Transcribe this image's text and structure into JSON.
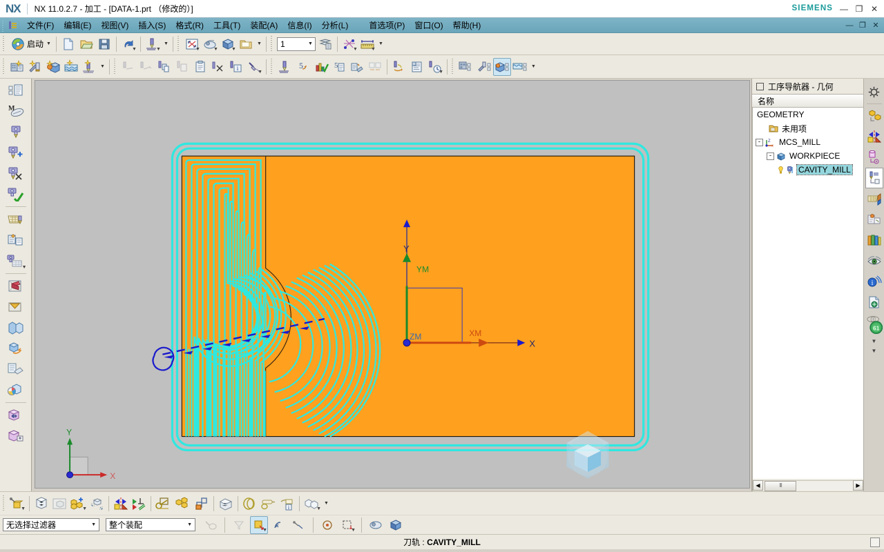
{
  "window": {
    "logo": "NX",
    "title": "NX 11.0.2.7 - 加工 - [DATA-1.prt （修改的）]",
    "brand": "SIEMENS",
    "minimize": "—",
    "restore": "❐",
    "close": "✕"
  },
  "menubar": {
    "items": [
      {
        "label": "文件(F)",
        "key": "F"
      },
      {
        "label": "编辑(E)",
        "key": "E"
      },
      {
        "label": "视图(V)",
        "key": "V"
      },
      {
        "label": "插入(S)",
        "key": "S"
      },
      {
        "label": "格式(R)",
        "key": "R"
      },
      {
        "label": "工具(T)",
        "key": "T"
      },
      {
        "label": "装配(A)",
        "key": "A"
      },
      {
        "label": "信息(I)",
        "key": "I"
      },
      {
        "label": "分析(L)",
        "key": "L"
      },
      {
        "label": "首选项(P)",
        "key": "P"
      },
      {
        "label": "窗口(O)",
        "key": "O"
      },
      {
        "label": "帮助(H)",
        "key": "H"
      }
    ],
    "min": "—",
    "restore": "❐",
    "close": "✕"
  },
  "toolbar_main": {
    "start_label": "启动",
    "value_field": "1",
    "buttons": [
      "start-button",
      "new-file",
      "open-file",
      "save-file",
      "undo",
      "generate-toolpath",
      "fit-view",
      "render-style",
      "shaded-view",
      "layer-settings",
      "display-value",
      "layer-manager",
      "move-object",
      "measure-distance"
    ]
  },
  "toolbar_machining": {
    "buttons": [
      "create-program",
      "create-tool",
      "create-geometry",
      "create-method",
      "create-operation",
      "cut-region",
      "transform-path",
      "copy-path",
      "paste-path",
      "delete-path",
      "path-info",
      "tool-path-list",
      "generate-tool-path",
      "replay-tool-path",
      "verify-tool-path",
      "list-tool-path",
      "post-process",
      "shop-documentation",
      "output-cls-file",
      "machine-code",
      "simulate-time",
      "program-order-view",
      "machine-tool-view",
      "geometry-view",
      "machining-method-view"
    ]
  },
  "navigator": {
    "title": "工序导航器 - 几何",
    "column_header": "名称",
    "tree": [
      {
        "label": "GEOMETRY",
        "depth": 0,
        "expander": "",
        "icon": "",
        "selected": false
      },
      {
        "label": "未用项",
        "depth": 1,
        "expander": "",
        "icon": "unused-items-icon",
        "selected": false
      },
      {
        "label": "MCS_MILL",
        "depth": 1,
        "expander": "-",
        "icon": "mcs-icon",
        "selected": false
      },
      {
        "label": "WORKPIECE",
        "depth": 2,
        "expander": "-",
        "icon": "workpiece-icon",
        "selected": false
      },
      {
        "label": "CAVITY_MILL",
        "depth": 3,
        "expander": "",
        "icon": "cavity-mill-icon",
        "warning": "!",
        "selected": true
      }
    ],
    "scroll_left": "◀",
    "scroll_right": "▶"
  },
  "viewport": {
    "mcs": {
      "x_label": "X",
      "y_label": "Y",
      "xm_label": "XM",
      "ym_label": "YM",
      "zm_label": "ZM"
    },
    "wcs": {
      "x_label": "X",
      "y_label": "Y"
    },
    "colors": {
      "workpiece": "#FFA01E",
      "toolpath": "#2FE8E0",
      "blank_boundary": "#2FE8E0",
      "rapid_move": "#1a1acc",
      "background": "#c0c0c0"
    },
    "dial_value": "61"
  },
  "filterbar": {
    "selection_filter": "无选择过滤器",
    "assembly_scope": "整个装配",
    "icons": [
      "snap-point",
      "filter-off",
      "select-feature",
      "select-point",
      "select-curve",
      "point-constructor",
      "rect-select",
      "render-style",
      "shaded-body"
    ]
  },
  "statusbar": {
    "prefix": "刀轨 :",
    "value": "CAVITY_MILL"
  },
  "rails": {
    "left_icons": [
      "assembly-navigator-icon",
      "part-navigator-icon",
      "reuse-library-icon",
      "hd3d-tools-icon",
      "web-browser-icon",
      "history-icon",
      "process-studio-icon",
      "role-icon",
      "system-scene-icon",
      "machining-feature-icon",
      "manufacturing-wizard-icon",
      "view-manager-icon",
      "scene-icon",
      "sketch-icon",
      "move-object-icon",
      "reposition-icon"
    ],
    "right_icons": [
      "settings-gear-icon",
      "geometry-group-icon",
      "mirror-icon",
      "cylinder-icon",
      "tool-path-icon",
      "layer-icon",
      "machine-icon",
      "library-icon",
      "eye-icon",
      "info-icon",
      "report-icon",
      "dial-icon"
    ]
  }
}
